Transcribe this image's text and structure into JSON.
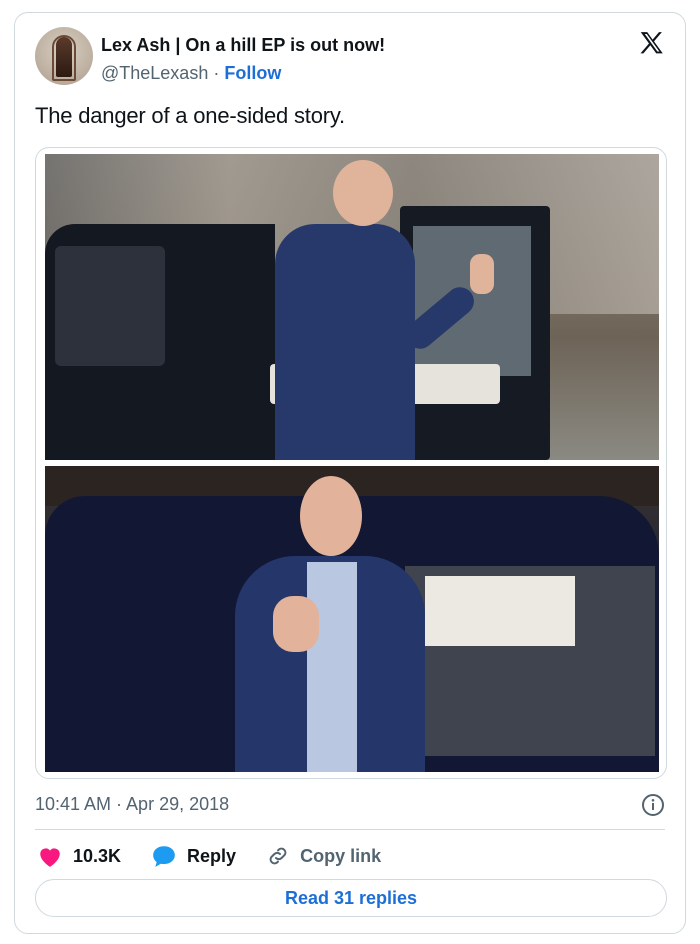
{
  "author": {
    "display_name": "Lex Ash | On a hill EP is out now!",
    "handle": "@TheLexash",
    "separator": "·",
    "follow_label": "Follow"
  },
  "brand": {
    "logo_icon": "x-logo-icon"
  },
  "tweet": {
    "text": "The danger of a one-sided story.",
    "timestamp": "10:41 AM · Apr 29, 2018"
  },
  "media": {
    "images": [
      {
        "name": "photo-top"
      },
      {
        "name": "photo-bottom"
      }
    ]
  },
  "actions": {
    "like_count": "10.3K",
    "reply_label": "Reply",
    "copy_label": "Copy link",
    "read_replies_label": "Read 31 replies"
  },
  "colors": {
    "accent": "#1d6fd6",
    "like": "#f91880",
    "text": "#0f1419",
    "secondary": "#536471",
    "border": "#cfd9de"
  }
}
